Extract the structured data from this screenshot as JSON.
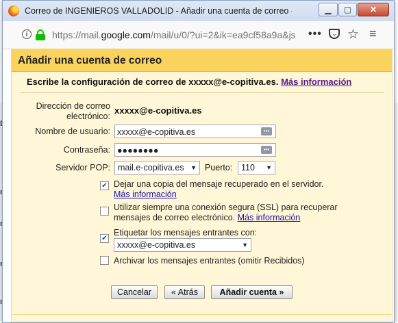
{
  "window": {
    "title": "Correo de INGENIEROS VALLADOLID - Añadir una cuenta de correo - Mozilla ...",
    "min_glyph": "▁",
    "max_glyph": "▢",
    "close_glyph": "✕"
  },
  "navbar": {
    "url_prefix": "https://mail.",
    "url_domain": "google.com",
    "url_rest": "/mail/u/0/?ui=2&ik=ea9cf58a9a&js",
    "menu_dots": "•••",
    "star_glyph": "☆",
    "menu_glyph": "≡"
  },
  "dialog": {
    "title": "Añadir una cuenta de correo",
    "intro_text": "Escribe la configuración de correo de xxxxx@e-copitiva.es.",
    "intro_link": "Más información",
    "email_label": "Dirección de correo electrónico:",
    "email_value": "xxxxx@e-copitiva.es",
    "username_label": "Nombre de usuario:",
    "username_value": "xxxxx@e-copitiva.es",
    "password_label": "Contraseña:",
    "password_value": "●●●●●●●●",
    "pop_label": "Servidor POP:",
    "pop_server": "mail.e-copitiva.es",
    "port_label": "Puerto:",
    "port_value": "110",
    "options": {
      "leave_copy": {
        "text": "Dejar una copia del mensaje recuperado en el servidor.",
        "link": "Más información",
        "checked": true
      },
      "ssl": {
        "text": "Utilizar siempre una conexión segura (SSL) para recuperar mensajes de correo electrónico.",
        "link": "Más información",
        "checked": false
      },
      "label_incoming": {
        "text": "Etiquetar los mensajes entrantes con:",
        "value": "xxxxx@e-copitiva.es",
        "checked": true
      },
      "archive": {
        "text": "Archivar los mensajes entrantes (omitir Recibidos)",
        "checked": false
      }
    },
    "buttons": {
      "cancel": "Cancelar",
      "back": "« Atrás",
      "add": "Añadir cuenta »"
    }
  },
  "background": {
    "left_fragments": [
      "D",
      "nt",
      "nt",
      "nt",
      "nt"
    ]
  },
  "colors": {
    "dialog_header": "#f9d35b",
    "dialog_body": "#fff7d7",
    "link": "#1a0dab",
    "visited_link": "#551a8b",
    "lock_green": "#12bc00"
  }
}
